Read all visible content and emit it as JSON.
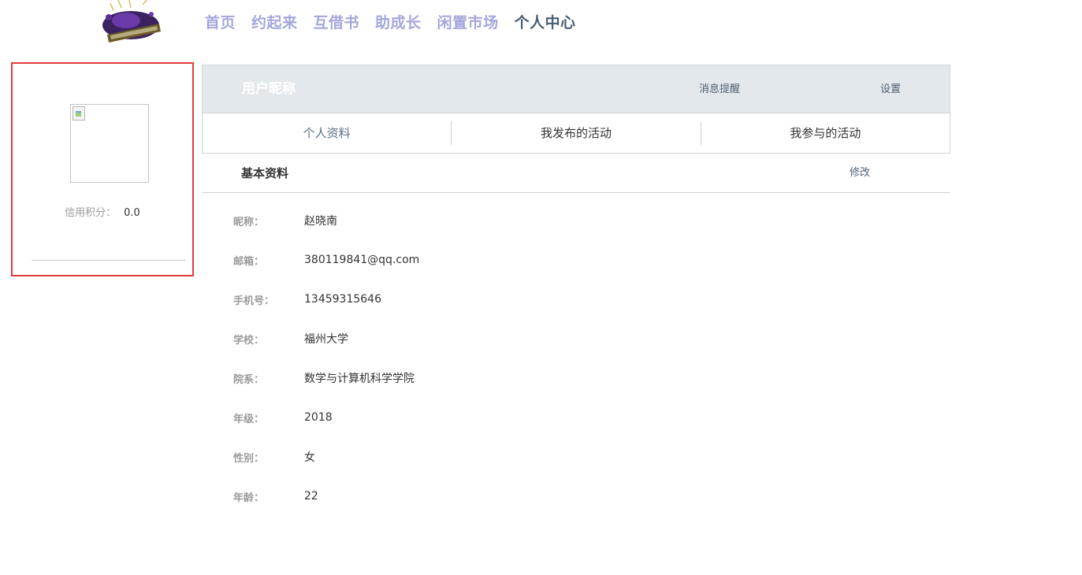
{
  "nav": {
    "items": [
      "首页",
      "约起来",
      "互借书",
      "助成长",
      "闲置市场",
      "个人中心"
    ],
    "active_index": 5
  },
  "profile_card": {
    "credit_label": "信用积分：",
    "credit_value": "0.0"
  },
  "banner": {
    "nickname": "用户昵称",
    "messages_label": "消息提醒",
    "settings_label": "设置"
  },
  "tabs": [
    "个人资料",
    "我发布的活动",
    "我参与的活动"
  ],
  "section": {
    "title": "基本资料",
    "edit_label": "修改"
  },
  "info": [
    {
      "label": "昵称：",
      "value": "赵晓南"
    },
    {
      "label": "邮箱：",
      "value": "380119841@qq.com"
    },
    {
      "label": "手机号：",
      "value": "13459315646"
    },
    {
      "label": "学校：",
      "value": "福州大学"
    },
    {
      "label": "院系：",
      "value": "数学与计算机科学学院"
    },
    {
      "label": "年级：",
      "value": "2018"
    },
    {
      "label": "性别：",
      "value": "女"
    },
    {
      "label": "年龄：",
      "value": "22"
    }
  ],
  "colors": {
    "nav_inactive": "#a4a7dc",
    "nav_active": "#4a5f73",
    "card_border": "#e33b3b",
    "banner_bg": "#e3e8ec"
  }
}
